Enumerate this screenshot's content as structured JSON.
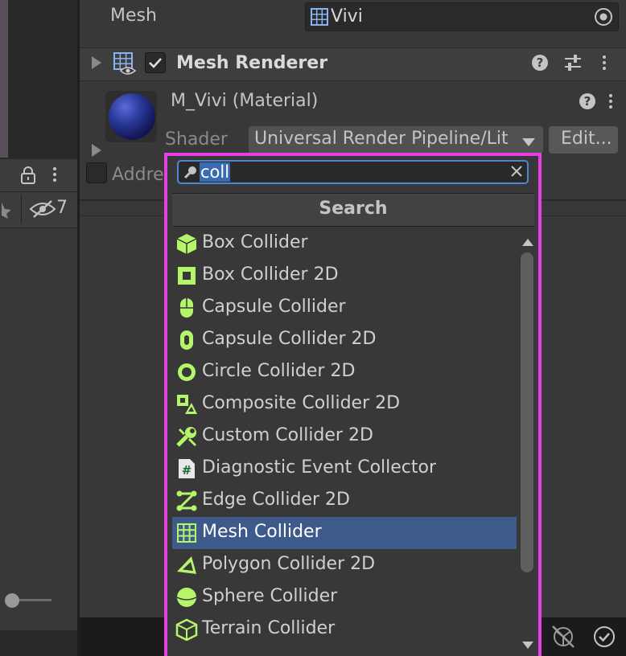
{
  "inspector": {
    "mesh_label": "Mesh",
    "mesh_value": "Vivi",
    "component_title": "Mesh Renderer",
    "material_name": "M_Vivi (Material)",
    "shader_label": "Shader",
    "shader_value": "Universal Render Pipeline/Lit",
    "edit_label": "Edit...",
    "addressable_label": "Addre"
  },
  "left_panel": {
    "hidden_count": "7"
  },
  "popup": {
    "search_value": "coll",
    "header": "Search",
    "items": [
      {
        "label": "Box Collider",
        "icon": "box-collider-icon"
      },
      {
        "label": "Box Collider 2D",
        "icon": "box-collider-2d-icon"
      },
      {
        "label": "Capsule Collider",
        "icon": "capsule-collider-icon"
      },
      {
        "label": "Capsule Collider 2D",
        "icon": "capsule-collider-2d-icon"
      },
      {
        "label": "Circle Collider 2D",
        "icon": "circle-collider-2d-icon"
      },
      {
        "label": "Composite Collider 2D",
        "icon": "composite-collider-2d-icon"
      },
      {
        "label": "Custom Collider 2D",
        "icon": "custom-collider-2d-icon"
      },
      {
        "label": "Diagnostic Event Collector",
        "icon": "script-icon"
      },
      {
        "label": "Edge Collider 2D",
        "icon": "edge-collider-2d-icon"
      },
      {
        "label": "Mesh Collider",
        "icon": "mesh-collider-icon"
      },
      {
        "label": "Polygon Collider 2D",
        "icon": "polygon-collider-2d-icon"
      },
      {
        "label": "Sphere Collider",
        "icon": "sphere-collider-icon"
      },
      {
        "label": "Terrain Collider",
        "icon": "terrain-collider-icon"
      }
    ],
    "selected_index": 9
  },
  "colors": {
    "popup_border": "#e53fe5",
    "selection": "#3d5a8a",
    "icon_green": "#b5f56a",
    "search_focus": "#4f86d0"
  }
}
